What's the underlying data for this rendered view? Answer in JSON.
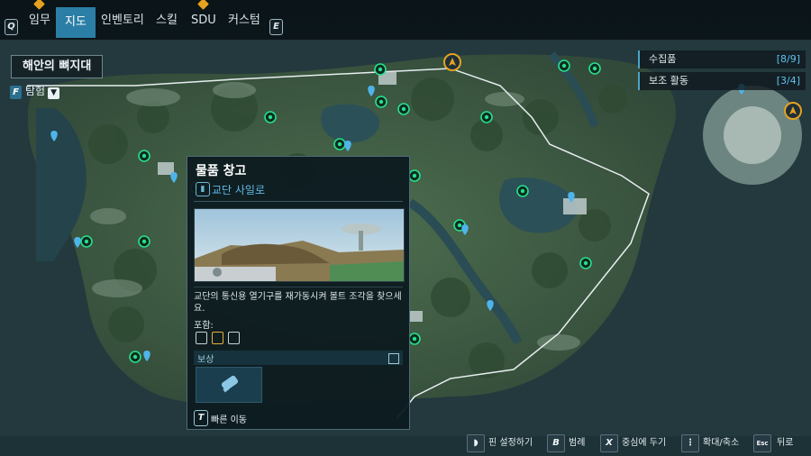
{
  "nav": {
    "left_key": "Q",
    "right_key": "E",
    "tabs": [
      {
        "label": "임무",
        "active": false,
        "pip": true
      },
      {
        "label": "지도",
        "active": true,
        "pip": false
      },
      {
        "label": "인벤토리",
        "active": false,
        "pip": false
      },
      {
        "label": "스킬",
        "active": false,
        "pip": false
      },
      {
        "label": "SDU",
        "active": false,
        "pip": true
      },
      {
        "label": "커스텀",
        "active": false,
        "pip": false
      }
    ]
  },
  "region": {
    "name": "해안의 뼈지대",
    "filter_key": "F",
    "filter_label": "탐험"
  },
  "collection": [
    {
      "label": "수집품",
      "count": "[8/9]"
    },
    {
      "label": "보조 활동",
      "count": "[3/4]"
    }
  ],
  "popup": {
    "title": "물품 창고",
    "subtitle": "교단 사일로",
    "description": "교단의 통신용 열기구를 재가동시켜 볼트 조각을 찾으세요.",
    "includes_label": "포함:",
    "include_icon_count": 3,
    "reward_label": "보상",
    "fast_travel_key": "T",
    "fast_travel_label": "빠른 이동"
  },
  "bottom_actions": [
    {
      "key": "◗",
      "label": "핀 설정하기"
    },
    {
      "key": "B",
      "label": "범례"
    },
    {
      "key": "X",
      "label": "중심에 두기"
    },
    {
      "key": "⋮",
      "label": "확대/축소"
    },
    {
      "key": "Esc",
      "label": "뒤로"
    }
  ],
  "colors": {
    "accent": "#2b7fa6",
    "count": "#5ec3ee",
    "pip": "#e6a21e",
    "marker_green": "#27e08a",
    "marker_blue": "#4fb4ea",
    "terrain": "#3d5a44",
    "water": "#2a4a52"
  },
  "map_markers": {
    "green_icon": "signal-tower-icon",
    "blue_icon": "location-pin-icon",
    "player_icon": "compass-arrow-icon"
  }
}
